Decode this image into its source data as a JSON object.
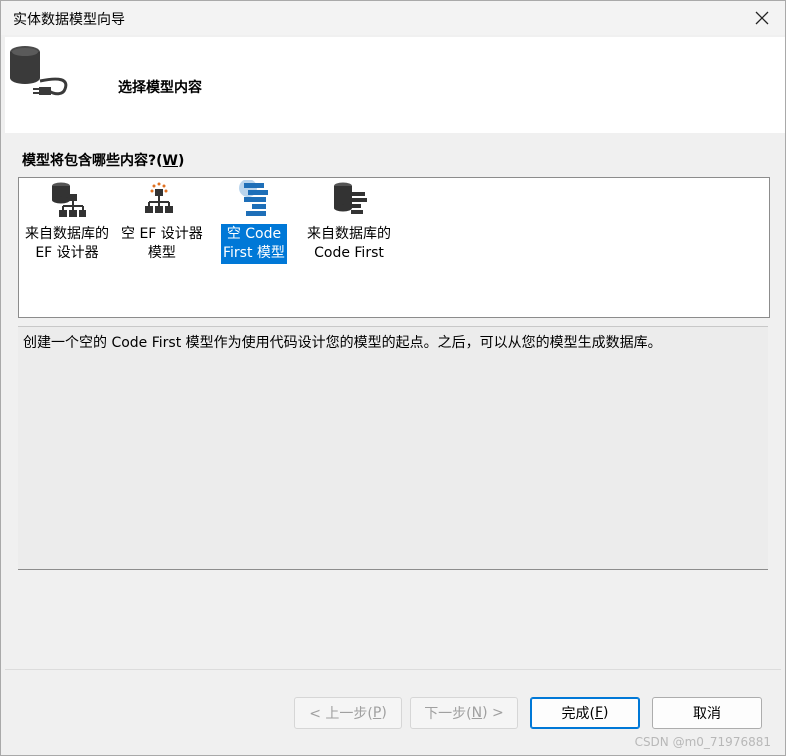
{
  "window": {
    "title": "实体数据模型向导",
    "close_glyph": "✕"
  },
  "header": {
    "title": "选择模型内容"
  },
  "question": {
    "text": "模型将包含哪些内容?(",
    "mnemonic": "W",
    "suffix": ")"
  },
  "models": [
    {
      "label": "来自数据库的\nEF 设计器",
      "icon": "database-hierarchy-icon",
      "selected": false
    },
    {
      "label": "空 EF 设计器\n模型",
      "icon": "empty-designer-icon",
      "selected": false
    },
    {
      "label": "空 Code\nFirst 模型",
      "icon": "code-first-icon",
      "selected": true
    },
    {
      "label": "来自数据库的\nCode First",
      "icon": "database-code-first-icon",
      "selected": false
    }
  ],
  "description": "创建一个空的 Code First 模型作为使用代码设计您的模型的起点。之后，可以从您的模型生成数据库。",
  "buttons": {
    "back": {
      "prefix": "< 上一步(",
      "key": "P",
      "suffix": ")"
    },
    "next": {
      "prefix": "下一步(",
      "key": "N",
      "suffix": ") >"
    },
    "finish": {
      "prefix": "完成(",
      "key": "F",
      "suffix": ")"
    },
    "cancel": {
      "label": "取消"
    }
  },
  "watermark": "CSDN @m0_71976881",
  "colors": {
    "selection": "#0078d7",
    "accent_blue": "#1e6fb8"
  }
}
